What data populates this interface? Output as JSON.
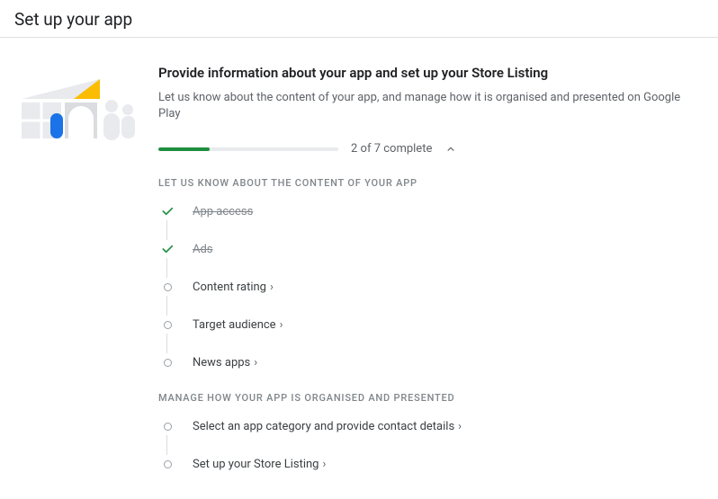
{
  "page_title": "Set up your app",
  "section": {
    "title": "Provide information about your app and set up your Store Listing",
    "subtitle": "Let us know about the content of your app, and manage how it is organised and presented on Google Play"
  },
  "progress": {
    "label": "2 of 7 complete",
    "completed": 2,
    "total": 7,
    "fill_percent": "28.5%"
  },
  "groups": [
    {
      "label": "LET US KNOW ABOUT THE CONTENT OF YOUR APP",
      "tasks": [
        {
          "label": "App access",
          "done": true
        },
        {
          "label": "Ads",
          "done": true
        },
        {
          "label": "Content rating",
          "done": false
        },
        {
          "label": "Target audience",
          "done": false
        },
        {
          "label": "News apps",
          "done": false
        }
      ]
    },
    {
      "label": "MANAGE HOW YOUR APP IS ORGANISED AND PRESENTED",
      "tasks": [
        {
          "label": "Select an app category and provide contact details",
          "done": false
        },
        {
          "label": "Set up your Store Listing",
          "done": false
        }
      ]
    }
  ]
}
